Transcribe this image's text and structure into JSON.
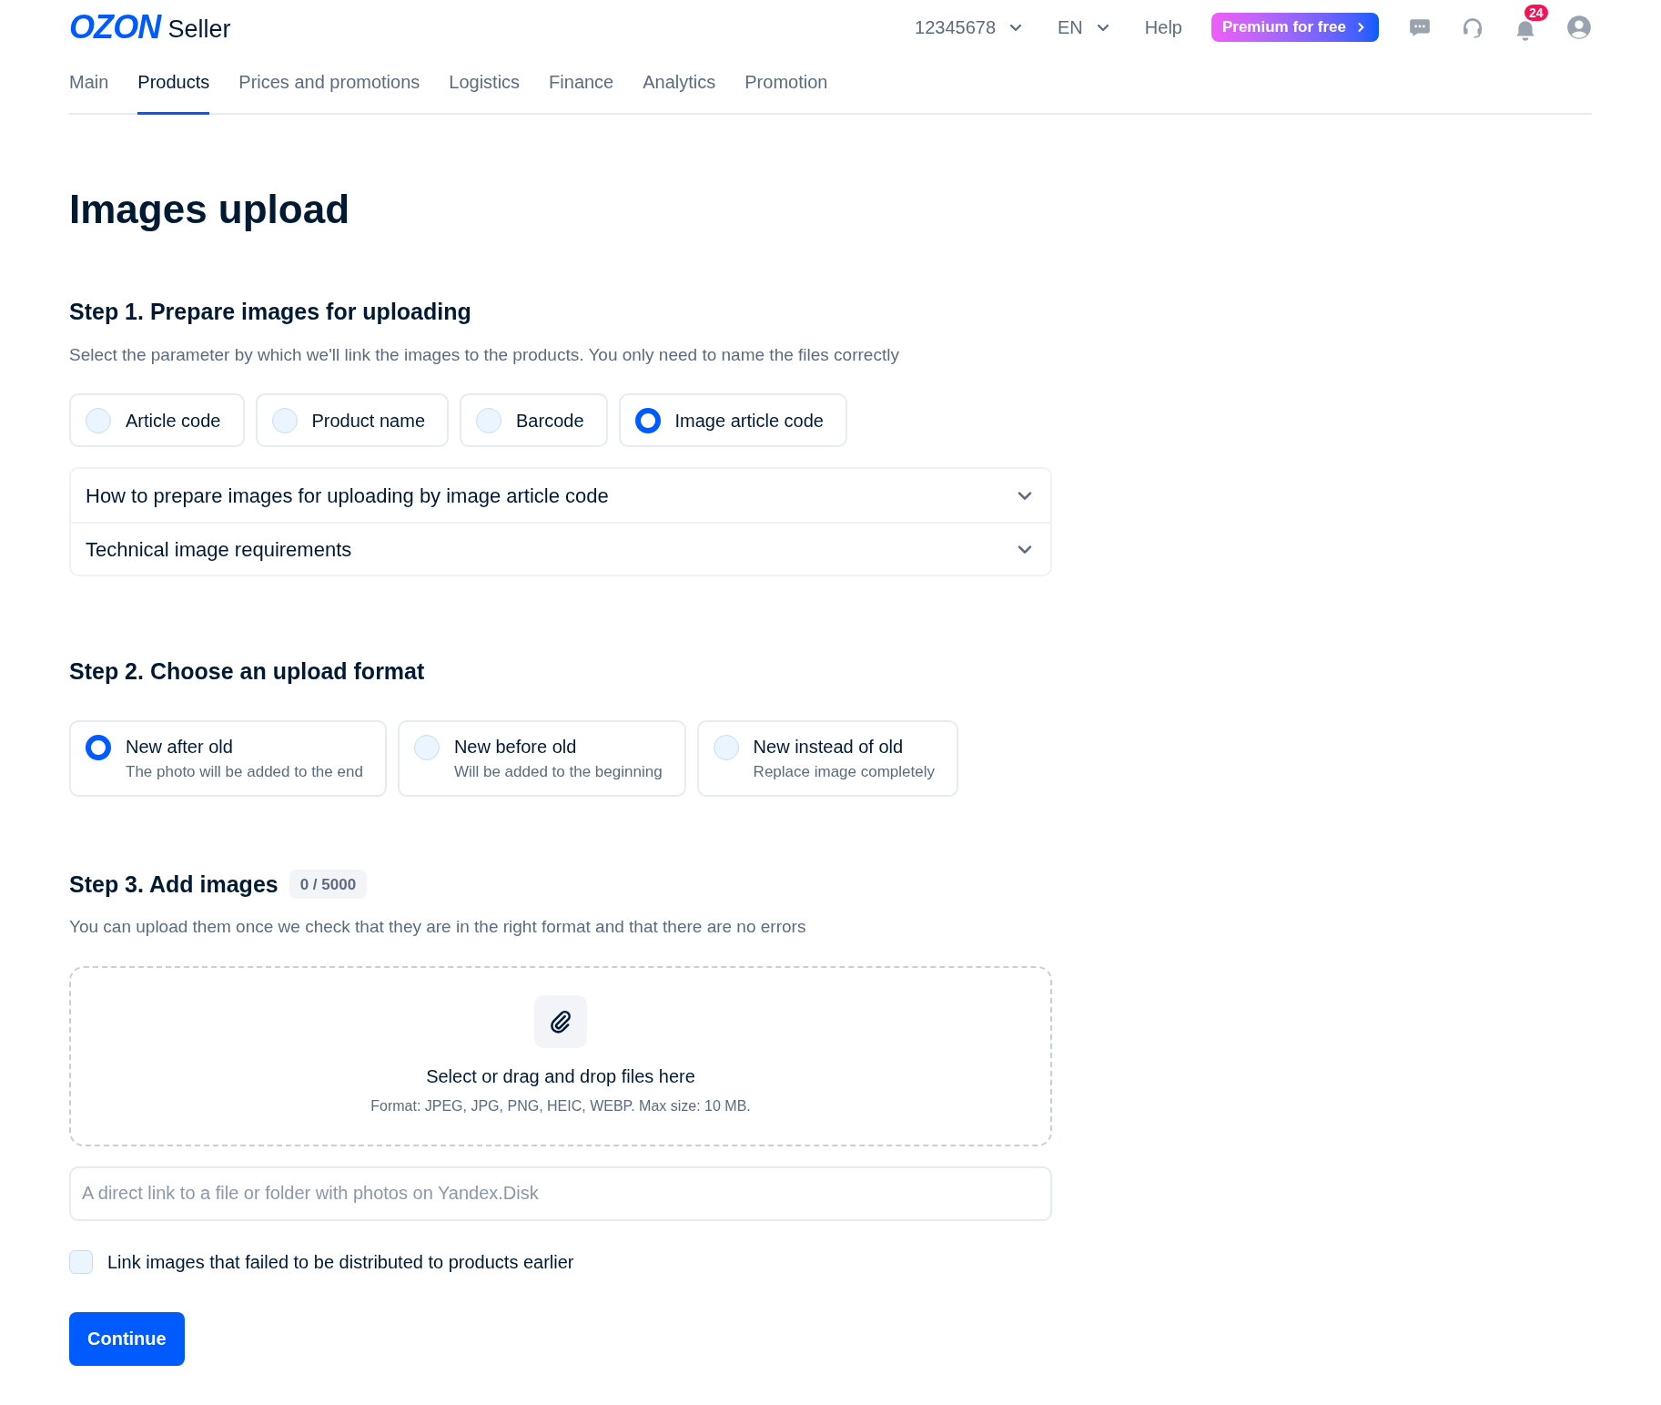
{
  "header": {
    "logo": "OZON",
    "logo_suffix": "Seller",
    "account": "12345678",
    "language": "EN",
    "help": "Help",
    "premium": "Premium for free",
    "notifications_count": "24"
  },
  "tabs": [
    {
      "label": "Main",
      "selected": false
    },
    {
      "label": "Products",
      "selected": true
    },
    {
      "label": "Prices and promotions",
      "selected": false
    },
    {
      "label": "Logistics",
      "selected": false
    },
    {
      "label": "Finance",
      "selected": false
    },
    {
      "label": "Analytics",
      "selected": false
    },
    {
      "label": "Promotion",
      "selected": false
    }
  ],
  "title": "Images upload",
  "step1": {
    "heading": "Step 1. Prepare images for uploading",
    "description": "Select the parameter by which we'll link the images to the products. You only need to name the files correctly",
    "options": [
      {
        "label": "Article code",
        "selected": false
      },
      {
        "label": "Product name",
        "selected": false
      },
      {
        "label": "Barcode",
        "selected": false
      },
      {
        "label": "Image article code",
        "selected": true
      }
    ],
    "accordion": [
      {
        "label": "How to prepare images for uploading by image article code",
        "expanded": false
      },
      {
        "label": "Technical image requirements",
        "expanded": false
      }
    ]
  },
  "step2": {
    "heading": "Step 2. Choose an upload format",
    "options": [
      {
        "label": "New after old",
        "hint": "The photo will be added to the end",
        "selected": true
      },
      {
        "label": "New before old",
        "hint": "Will be added to the beginning",
        "selected": false
      },
      {
        "label": "New instead of old",
        "hint": "Replace image completely",
        "selected": false
      }
    ]
  },
  "step3": {
    "heading": "Step 3. Add images",
    "counter": "0 / 5000",
    "description": "You can upload them once we check that they are in the right format and that there are no errors",
    "dropzone": {
      "title": "Select or drag and drop files here",
      "hint": "Format: JPEG, JPG, PNG, HEIC, WEBP. Max size: 10 MB."
    },
    "link_field": {
      "placeholder": "A direct link to a file or folder with photos on Yandex.Disk"
    },
    "checkbox": {
      "label": "Link images that failed to be distributed to products earlier",
      "checked": false
    }
  },
  "continue_button": "Continue"
}
